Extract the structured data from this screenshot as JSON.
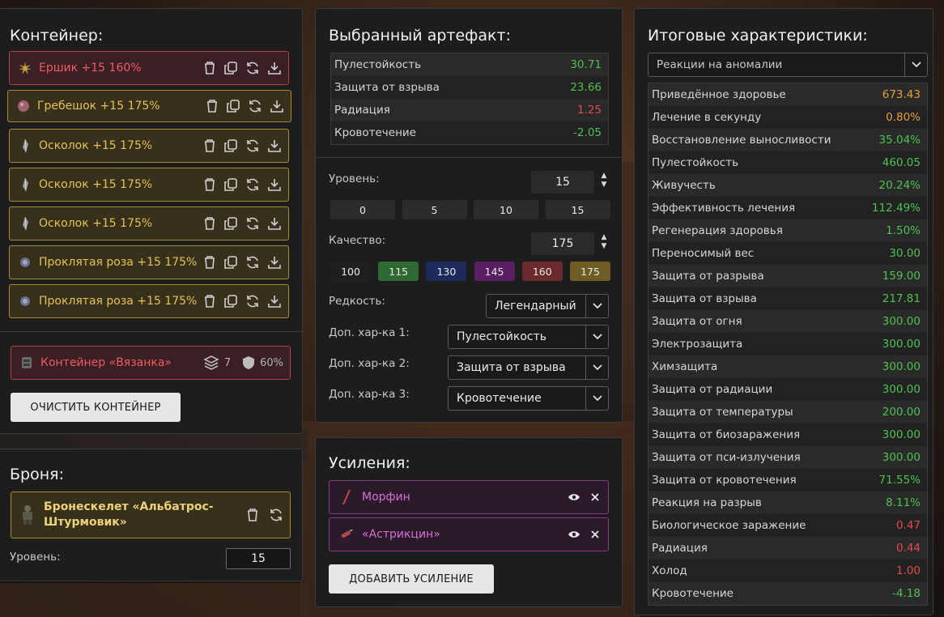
{
  "container": {
    "title": "Контейнер:",
    "items": [
      {
        "name": "Ершик +15 160%",
        "style": "red",
        "icon": "spiky-artifact-icon"
      },
      {
        "name": "Гребешок +15 175%",
        "style": "gold",
        "icon": "crest-artifact-icon"
      },
      {
        "name": "Осколок +15 175%",
        "style": "gold",
        "icon": "shard-artifact-icon"
      },
      {
        "name": "Осколок +15 175%",
        "style": "gold",
        "icon": "shard-artifact-icon"
      },
      {
        "name": "Осколок +15 175%",
        "style": "gold",
        "icon": "shard-artifact-icon"
      },
      {
        "name": "Проклятая роза +15 175%",
        "style": "gold",
        "icon": "rose-artifact-icon"
      },
      {
        "name": "Проклятая роза +15 175%",
        "style": "gold",
        "icon": "rose-artifact-icon"
      }
    ],
    "container_item": {
      "name": "Контейнер «Вязанка»",
      "slots": "7",
      "protection": "60%"
    },
    "clear_label": "ОЧИСТИТЬ КОНТЕЙНЕР"
  },
  "armor": {
    "title": "Броня:",
    "name": "Бронескелет «Альбатрос-Штурмовик»",
    "level_label": "Уровень:",
    "level_value": "15"
  },
  "artifact": {
    "title": "Выбранный артефакт:",
    "stats": [
      {
        "label": "Пулестойкость",
        "value": "30.71",
        "color": "green"
      },
      {
        "label": "Защита от взрыва",
        "value": "23.66",
        "color": "green"
      },
      {
        "label": "Радиация",
        "value": "1.25",
        "color": "red"
      },
      {
        "label": "Кровотечение",
        "value": "-2.05",
        "color": "green"
      }
    ],
    "level_label": "Уровень:",
    "level_value": "15",
    "level_presets": [
      "0",
      "5",
      "10",
      "15"
    ],
    "quality_label": "Качество:",
    "quality_value": "175",
    "quality_presets": [
      {
        "label": "100",
        "color": "#1f1f20"
      },
      {
        "label": "115",
        "color": "#2f6a35"
      },
      {
        "label": "130",
        "color": "#1f2a5c"
      },
      {
        "label": "145",
        "color": "#5a1e63"
      },
      {
        "label": "160",
        "color": "#6a2a2e"
      },
      {
        "label": "175",
        "color": "#6e5e24"
      }
    ],
    "rarity_label": "Редкость:",
    "rarity_value": "Легендарный",
    "extra1_label": "Доп. хар-ка 1:",
    "extra1_value": "Пулестойкость",
    "extra2_label": "Доп. хар-ка 2:",
    "extra2_value": "Защита от взрыва",
    "extra3_label": "Доп. хар-ка 3:",
    "extra3_value": "Кровотечение"
  },
  "boosts": {
    "title": "Усиления:",
    "items": [
      {
        "name": "Морфин",
        "icon": "syringe-icon"
      },
      {
        "name": "«Астрикцин»",
        "icon": "injector-icon"
      }
    ],
    "add_label": "ДОБАВИТЬ УСИЛЕНИЕ"
  },
  "totals": {
    "title": "Итоговые характеристики:",
    "filter_value": "Реакции на аномалии",
    "stats": [
      {
        "label": "Приведённое здоровье",
        "value": "673.43",
        "color": "orange"
      },
      {
        "label": "Лечение в секунду",
        "value": "0.80%",
        "color": "orange"
      },
      {
        "label": "Восстановление выносливости",
        "value": "35.04%",
        "color": "green"
      },
      {
        "label": "Пулестойкость",
        "value": "460.05",
        "color": "green"
      },
      {
        "label": "Живучесть",
        "value": "20.24%",
        "color": "green"
      },
      {
        "label": "Эффективность лечения",
        "value": "112.49%",
        "color": "green"
      },
      {
        "label": "Регенерация здоровья",
        "value": "1.50%",
        "color": "green"
      },
      {
        "label": "Переносимый вес",
        "value": "30.00",
        "color": "green"
      },
      {
        "label": "Защита от разрыва",
        "value": "159.00",
        "color": "green"
      },
      {
        "label": "Защита от взрыва",
        "value": "217.81",
        "color": "green"
      },
      {
        "label": "Защита от огня",
        "value": "300.00",
        "color": "green"
      },
      {
        "label": "Электрозащита",
        "value": "300.00",
        "color": "green"
      },
      {
        "label": "Химзащита",
        "value": "300.00",
        "color": "green"
      },
      {
        "label": "Защита от радиации",
        "value": "300.00",
        "color": "green"
      },
      {
        "label": "Защита от температуры",
        "value": "200.00",
        "color": "green"
      },
      {
        "label": "Защита от биозаражения",
        "value": "300.00",
        "color": "green"
      },
      {
        "label": "Защита от пси-излучения",
        "value": "300.00",
        "color": "green"
      },
      {
        "label": "Защита от кровотечения",
        "value": "71.55%",
        "color": "green"
      },
      {
        "label": "Реакция на разрыв",
        "value": "8.11%",
        "color": "green"
      },
      {
        "label": "Биологическое заражение",
        "value": "0.47",
        "color": "red"
      },
      {
        "label": "Радиация",
        "value": "0.44",
        "color": "red"
      },
      {
        "label": "Холод",
        "value": "1.00",
        "color": "red"
      },
      {
        "label": "Кровотечение",
        "value": "-4.18",
        "color": "green"
      }
    ]
  }
}
